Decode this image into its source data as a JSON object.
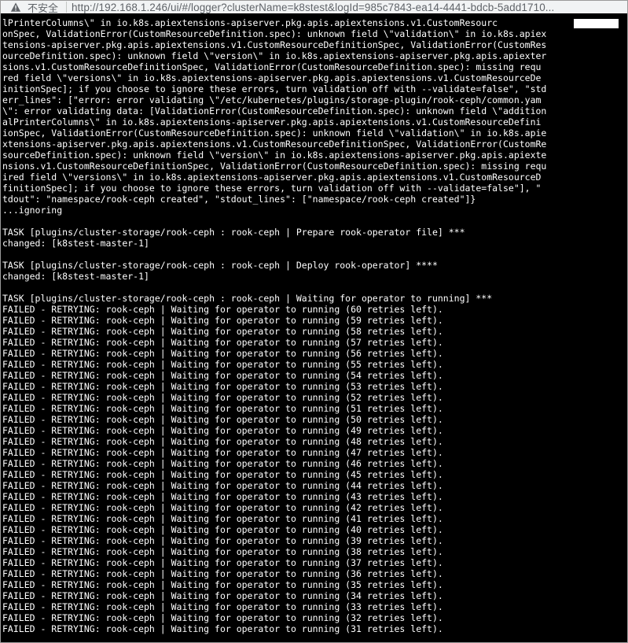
{
  "browser": {
    "security_label": "不安全",
    "url": "http://192.168.1.246/ui/#/logger?clusterName=k8stest&logId=985c7843-ea14-4441-bdcb-5add1710..."
  },
  "colors": {
    "console_background": "#000000",
    "console_text": "#ffffff",
    "address_bar_background": "#f1f3f4",
    "address_text": "#5f6368"
  },
  "log_lines": [
    "lPrinterColumns\\\" in io.k8s.apiextensions-apiserver.pkg.apis.apiextensions.v1.CustomResourc",
    "onSpec, ValidationError(CustomResourceDefinition.spec): unknown field \\\"validation\\\" in io.k8s.apiex",
    "tensions-apiserver.pkg.apis.apiextensions.v1.CustomResourceDefinitionSpec, ValidationError(CustomRes",
    "ourceDefinition.spec): unknown field \\\"version\\\" in io.k8s.apiextensions-apiserver.pkg.apis.apiexter",
    "sions.v1.CustomResourceDefinitionSpec, ValidationError(CustomResourceDefinition.spec): missing requ",
    "red field \\\"versions\\\" in io.k8s.apiextensions-apiserver.pkg.apis.apiextensions.v1.CustomResourceDe",
    "initionSpec]; if you choose to ignore these errors, turn validation off with --validate=false\", \"std",
    "err_lines\": [\"error: error validating \\\"/etc/kubernetes/plugins/storage-plugin/rook-ceph/common.yam",
    "\\\": error validating data: [ValidationError(CustomResourceDefinition.spec): unknown field \\\"addition",
    "alPrinterColumns\\\" in io.k8s.apiextensions-apiserver.pkg.apis.apiextensions.v1.CustomResourceDefini",
    "ionSpec, ValidationError(CustomResourceDefinition.spec): unknown field \\\"validation\\\" in io.k8s.apie",
    "xtensions-apiserver.pkg.apis.apiextensions.v1.CustomResourceDefinitionSpec, ValidationError(CustomRe",
    "sourceDefinition.spec): unknown field \\\"version\\\" in io.k8s.apiextensions-apiserver.pkg.apis.apiexte",
    "nsions.v1.CustomResourceDefinitionSpec, ValidationError(CustomResourceDefinition.spec): missing requ",
    "ired field \\\"versions\\\" in io.k8s.apiextensions-apiserver.pkg.apis.apiextensions.v1.CustomResourceD",
    "finitionSpec]; if you choose to ignore these errors, turn validation off with --validate=false\"], \"",
    "tdout\": \"namespace/rook-ceph created\", \"stdout_lines\": [\"namespace/rook-ceph created\"]}",
    "...ignoring",
    "",
    "TASK [plugins/cluster-storage/rook-ceph : rook-ceph | Prepare rook-operator file] ***",
    "changed: [k8stest-master-1]",
    "",
    "TASK [plugins/cluster-storage/rook-ceph : rook-ceph | Deploy rook-operator] ****",
    "changed: [k8stest-master-1]",
    "",
    "TASK [plugins/cluster-storage/rook-ceph : rook-ceph | Waiting for operator to running] ***",
    "FAILED - RETRYING: rook-ceph | Waiting for operator to running (60 retries left).",
    "FAILED - RETRYING: rook-ceph | Waiting for operator to running (59 retries left).",
    "FAILED - RETRYING: rook-ceph | Waiting for operator to running (58 retries left).",
    "FAILED - RETRYING: rook-ceph | Waiting for operator to running (57 retries left).",
    "FAILED - RETRYING: rook-ceph | Waiting for operator to running (56 retries left).",
    "FAILED - RETRYING: rook-ceph | Waiting for operator to running (55 retries left).",
    "FAILED - RETRYING: rook-ceph | Waiting for operator to running (54 retries left).",
    "FAILED - RETRYING: rook-ceph | Waiting for operator to running (53 retries left).",
    "FAILED - RETRYING: rook-ceph | Waiting for operator to running (52 retries left).",
    "FAILED - RETRYING: rook-ceph | Waiting for operator to running (51 retries left).",
    "FAILED - RETRYING: rook-ceph | Waiting for operator to running (50 retries left).",
    "FAILED - RETRYING: rook-ceph | Waiting for operator to running (49 retries left).",
    "FAILED - RETRYING: rook-ceph | Waiting for operator to running (48 retries left).",
    "FAILED - RETRYING: rook-ceph | Waiting for operator to running (47 retries left).",
    "FAILED - RETRYING: rook-ceph | Waiting for operator to running (46 retries left).",
    "FAILED - RETRYING: rook-ceph | Waiting for operator to running (45 retries left).",
    "FAILED - RETRYING: rook-ceph | Waiting for operator to running (44 retries left).",
    "FAILED - RETRYING: rook-ceph | Waiting for operator to running (43 retries left).",
    "FAILED - RETRYING: rook-ceph | Waiting for operator to running (42 retries left).",
    "FAILED - RETRYING: rook-ceph | Waiting for operator to running (41 retries left).",
    "FAILED - RETRYING: rook-ceph | Waiting for operator to running (40 retries left).",
    "FAILED - RETRYING: rook-ceph | Waiting for operator to running (39 retries left).",
    "FAILED - RETRYING: rook-ceph | Waiting for operator to running (38 retries left).",
    "FAILED - RETRYING: rook-ceph | Waiting for operator to running (37 retries left).",
    "FAILED - RETRYING: rook-ceph | Waiting for operator to running (36 retries left).",
    "FAILED - RETRYING: rook-ceph | Waiting for operator to running (35 retries left).",
    "FAILED - RETRYING: rook-ceph | Waiting for operator to running (34 retries left).",
    "FAILED - RETRYING: rook-ceph | Waiting for operator to running (33 retries left).",
    "FAILED - RETRYING: rook-ceph | Waiting for operator to running (32 retries left).",
    "FAILED - RETRYING: rook-ceph | Waiting for operator to running (31 retries left)."
  ]
}
